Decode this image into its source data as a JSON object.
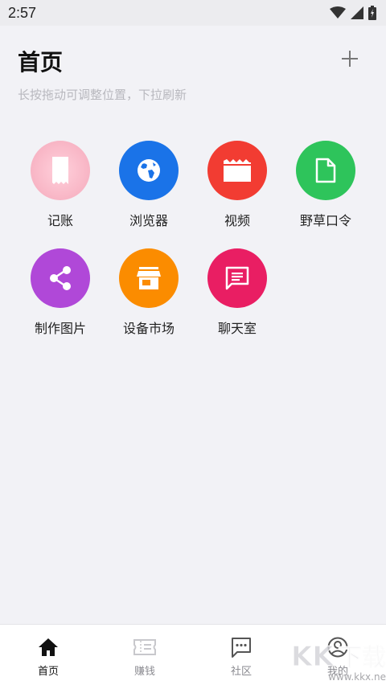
{
  "status_bar": {
    "time": "2:57"
  },
  "header": {
    "title": "首页",
    "add_icon": "plus-icon"
  },
  "hint": "长按拖动可调整位置，下拉刷新",
  "apps": [
    {
      "label": "记账",
      "icon": "receipt-icon",
      "color": "#f7b3c3"
    },
    {
      "label": "浏览器",
      "icon": "globe-icon",
      "color": "#1a73e8"
    },
    {
      "label": "视频",
      "icon": "clapperboard-icon",
      "color": "#f23c32"
    },
    {
      "label": "野草口令",
      "icon": "document-icon",
      "color": "#2ec45b"
    },
    {
      "label": "制作图片",
      "icon": "share-icon",
      "color": "#b048d8"
    },
    {
      "label": "设备市场",
      "icon": "store-icon",
      "color": "#fb8c00"
    },
    {
      "label": "聊天室",
      "icon": "message-icon",
      "color": "#e91e63"
    }
  ],
  "bottom_nav": {
    "items": [
      {
        "label": "首页",
        "icon": "home-icon",
        "active": true
      },
      {
        "label": "赚钱",
        "icon": "ticket-icon",
        "active": false
      },
      {
        "label": "社区",
        "icon": "chat-bubble-icon",
        "active": false
      },
      {
        "label": "我的",
        "icon": "profile-icon",
        "active": false
      }
    ]
  },
  "watermark": {
    "text": "KK下载",
    "url": "www.kkx.net"
  }
}
